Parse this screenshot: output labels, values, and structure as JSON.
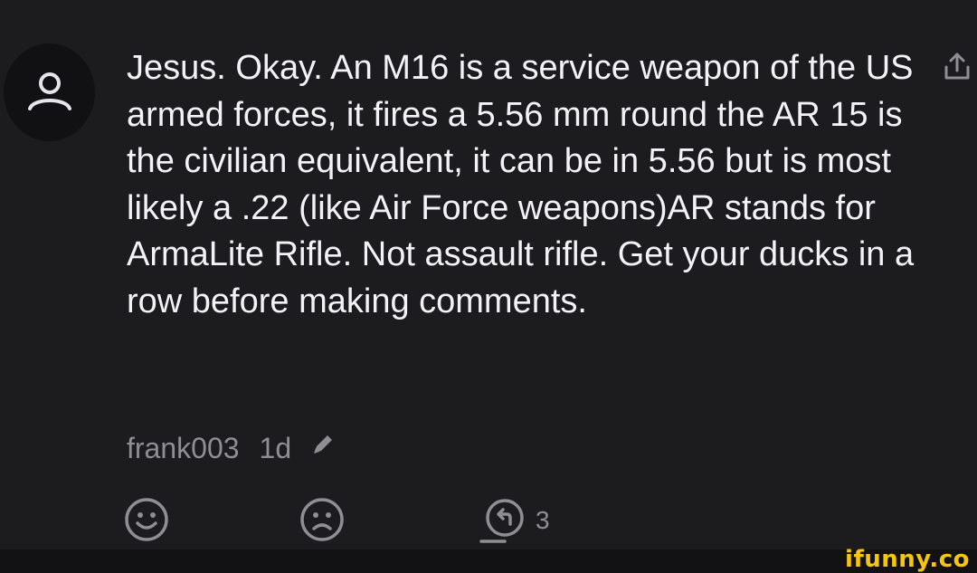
{
  "comment": {
    "text": "Jesus. Okay. An M16 is a service weapon of the US armed forces, it fires a 5.56 mm round the AR 15 is the civilian equivalent, it can be in 5.56 but is most likely a .22 (like Air Force weapons)AR stands for ArmaLite Rifle. Not assault rifle. Get your ducks in a row before making comments.",
    "author": "frank003",
    "time": "1d"
  },
  "actions": {
    "reply_count": "3"
  },
  "icons": {
    "avatar": "user-icon",
    "share": "share-icon",
    "edit": "pencil-icon",
    "like": "smile-icon",
    "dislike": "frown-icon",
    "reply": "reply-icon"
  },
  "colors": {
    "background": "#1c1c1e",
    "text": "#f2f2f7",
    "muted": "#8e8e93",
    "watermark": "#f7c60a"
  },
  "watermark": "ifunny.co"
}
